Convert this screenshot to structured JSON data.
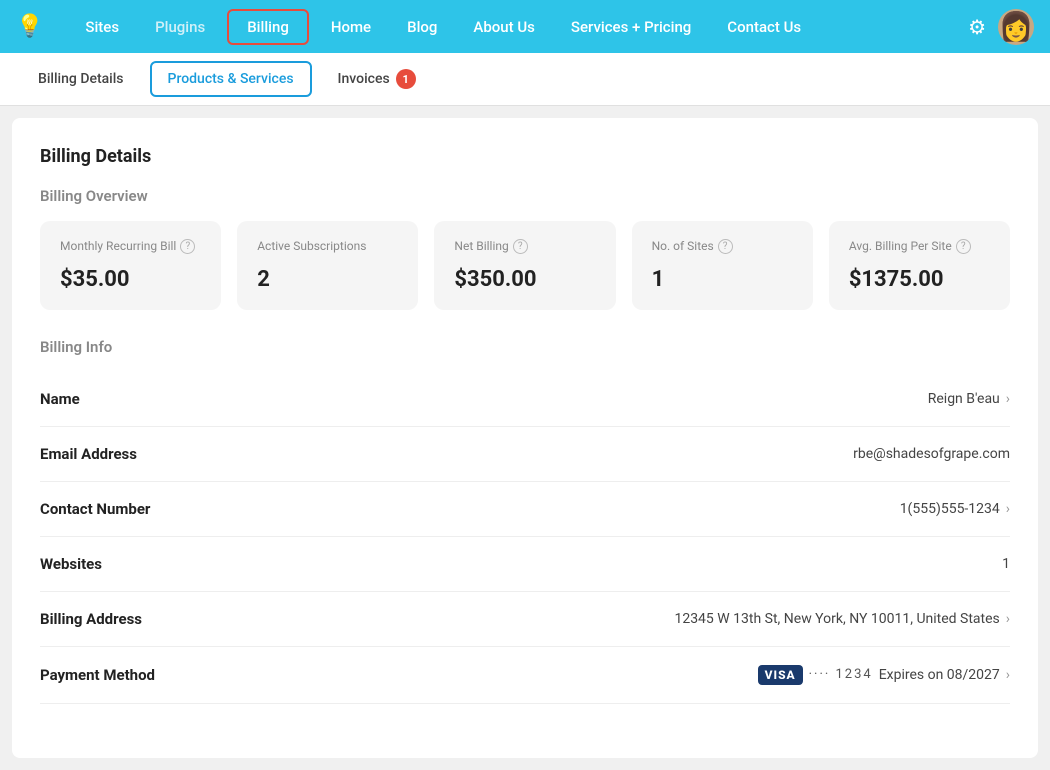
{
  "nav": {
    "logo": "💡",
    "links": [
      {
        "id": "sites",
        "label": "Sites",
        "active": false,
        "muted": false
      },
      {
        "id": "plugins",
        "label": "Plugins",
        "active": false,
        "muted": true
      },
      {
        "id": "billing",
        "label": "Billing",
        "active": true,
        "muted": false
      },
      {
        "id": "home",
        "label": "Home",
        "active": false,
        "muted": false
      },
      {
        "id": "blog",
        "label": "Blog",
        "active": false,
        "muted": false
      },
      {
        "id": "about-us",
        "label": "About Us",
        "active": false,
        "muted": false
      },
      {
        "id": "services-pricing",
        "label": "Services + Pricing",
        "active": false,
        "muted": false
      },
      {
        "id": "contact-us",
        "label": "Contact Us",
        "active": false,
        "muted": false
      }
    ],
    "gear_icon": "⚙",
    "avatar_icon": "👩"
  },
  "sub_nav": {
    "items": [
      {
        "id": "billing-details",
        "label": "Billing Details",
        "active": false
      },
      {
        "id": "products-services",
        "label": "Products & Services",
        "active": true
      },
      {
        "id": "invoices",
        "label": "Invoices",
        "active": false
      }
    ],
    "invoice_badge": "1"
  },
  "main": {
    "page_title": "Billing Details",
    "billing_overview_title": "Billing Overview",
    "cards": [
      {
        "id": "monthly-recurring",
        "label": "Monthly Recurring Bill",
        "has_help": true,
        "value": "$35.00"
      },
      {
        "id": "active-subscriptions",
        "label": "Active Subscriptions",
        "has_help": false,
        "value": "2"
      },
      {
        "id": "net-billing",
        "label": "Net Billing",
        "has_help": true,
        "value": "$350.00"
      },
      {
        "id": "no-of-sites",
        "label": "No. of Sites",
        "has_help": true,
        "value": "1"
      },
      {
        "id": "avg-billing-per-site",
        "label": "Avg. Billing Per Site",
        "has_help": true,
        "value": "$1375.00"
      }
    ],
    "billing_info_title": "Billing Info",
    "info_rows": [
      {
        "id": "name",
        "label": "Name",
        "value": "Reign B'eau",
        "has_chevron": true,
        "type": "text"
      },
      {
        "id": "email",
        "label": "Email Address",
        "value": "rbe@shadesofgrape.com",
        "has_chevron": false,
        "type": "text"
      },
      {
        "id": "contact-number",
        "label": "Contact Number",
        "value": "1(555)555-1234",
        "has_chevron": true,
        "type": "text"
      },
      {
        "id": "websites",
        "label": "Websites",
        "value": "1",
        "has_chevron": false,
        "type": "text"
      },
      {
        "id": "billing-address",
        "label": "Billing Address",
        "value": "12345 W 13th St, New York, NY 10011, United States",
        "has_chevron": true,
        "type": "text"
      },
      {
        "id": "payment-method",
        "label": "Payment Method",
        "value": "",
        "has_chevron": true,
        "type": "payment",
        "payment": {
          "brand": "VISA",
          "dots": "····",
          "last4": "1234",
          "expires_label": "Expires on",
          "expires": "08/2027"
        }
      }
    ]
  }
}
